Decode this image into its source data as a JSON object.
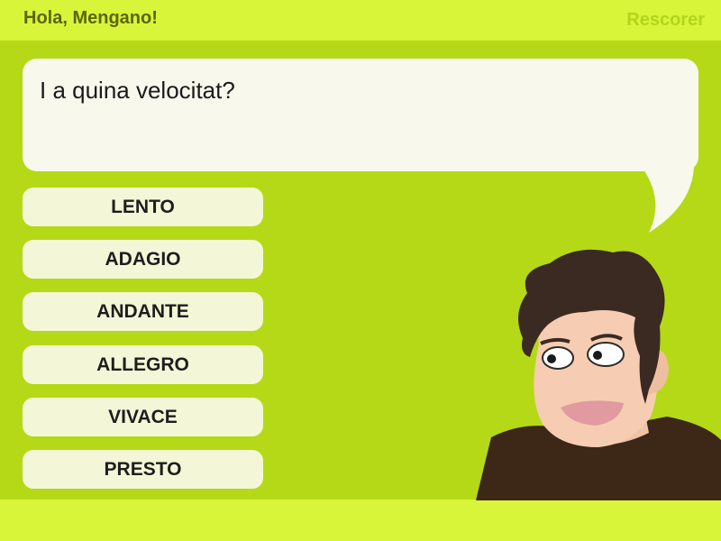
{
  "header": {
    "greeting": "Hola, Mengano!",
    "rescore_label": "Rescorer"
  },
  "question": {
    "text": "I a quina velocitat?"
  },
  "answers": [
    {
      "label": "LENTO"
    },
    {
      "label": "ADAGIO"
    },
    {
      "label": "ANDANTE"
    },
    {
      "label": "ALLEGRO"
    },
    {
      "label": "VIVACE"
    },
    {
      "label": "PRESTO"
    }
  ],
  "colors": {
    "background": "#b5d916",
    "bar": "#d8f53a",
    "bubble": "#f8f8ed",
    "answer_button": "#f4f7d7",
    "greeting_text": "#5a6608",
    "rescore_text": "#b3d41a"
  },
  "character": {
    "icon": "cartoon-man-illustration"
  }
}
